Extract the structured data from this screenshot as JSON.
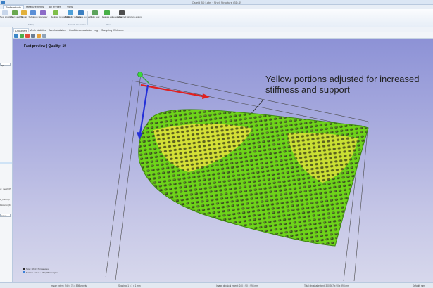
{
  "window": {
    "title": "Osteid 3D Labs · Shell Structure (3D-4)"
  },
  "menu_tabs": [
    "Surface tools",
    "Measurements",
    "3D Printer",
    "View"
  ],
  "ribbon": {
    "buttons": [
      "New structure",
      "Check and fix",
      "Group",
      "Subgroup",
      "Boundary",
      "Register to scaffolding",
      "Mesh by surface",
      "Surface to mesh",
      "Auto seal",
      "Feature edge volume",
      "Advanced structure extend"
    ],
    "groups": [
      "Editing",
      "Remesh interaction",
      "Offset"
    ]
  },
  "doc_tabs": [
    "Document",
    "Mesh statistics",
    "Mesh statistics",
    "Confidence statistics",
    "Log",
    "Sampling",
    "Welcome"
  ],
  "left_panel": {
    "labels": [
      "Spli",
      "ol_mesh (P",
      "lt_mesh (P",
      "Plotsrun (Ki",
      "Select"
    ]
  },
  "viewport": {
    "caption": "Fast preview | Quality: 10",
    "annotation_line1": "Yellow portions adjusted for increased",
    "annotation_line2": "stiffness and support",
    "legend": [
      "Total : 334,576 triangles",
      "Surface extent : 155,908 triangles"
    ]
  },
  "status": {
    "image_extent": "Image extent: 240 x 78 x 898 voxels",
    "spacing": "Spacing: 1 x 1 x 1 mm",
    "physical_extent": "Image physical extent: 240 x 90 x 998 mm",
    "total_extent": "Total physical extent: 300.987 x 90 x 998 mm",
    "units": "Default: mm"
  },
  "colors": {
    "mesh_green": "#7fe01f",
    "mesh_yellow": "#d8e43a",
    "axis_x": "#e02020",
    "axis_y": "#2430d8",
    "axis_origin": "#3ad83a"
  }
}
